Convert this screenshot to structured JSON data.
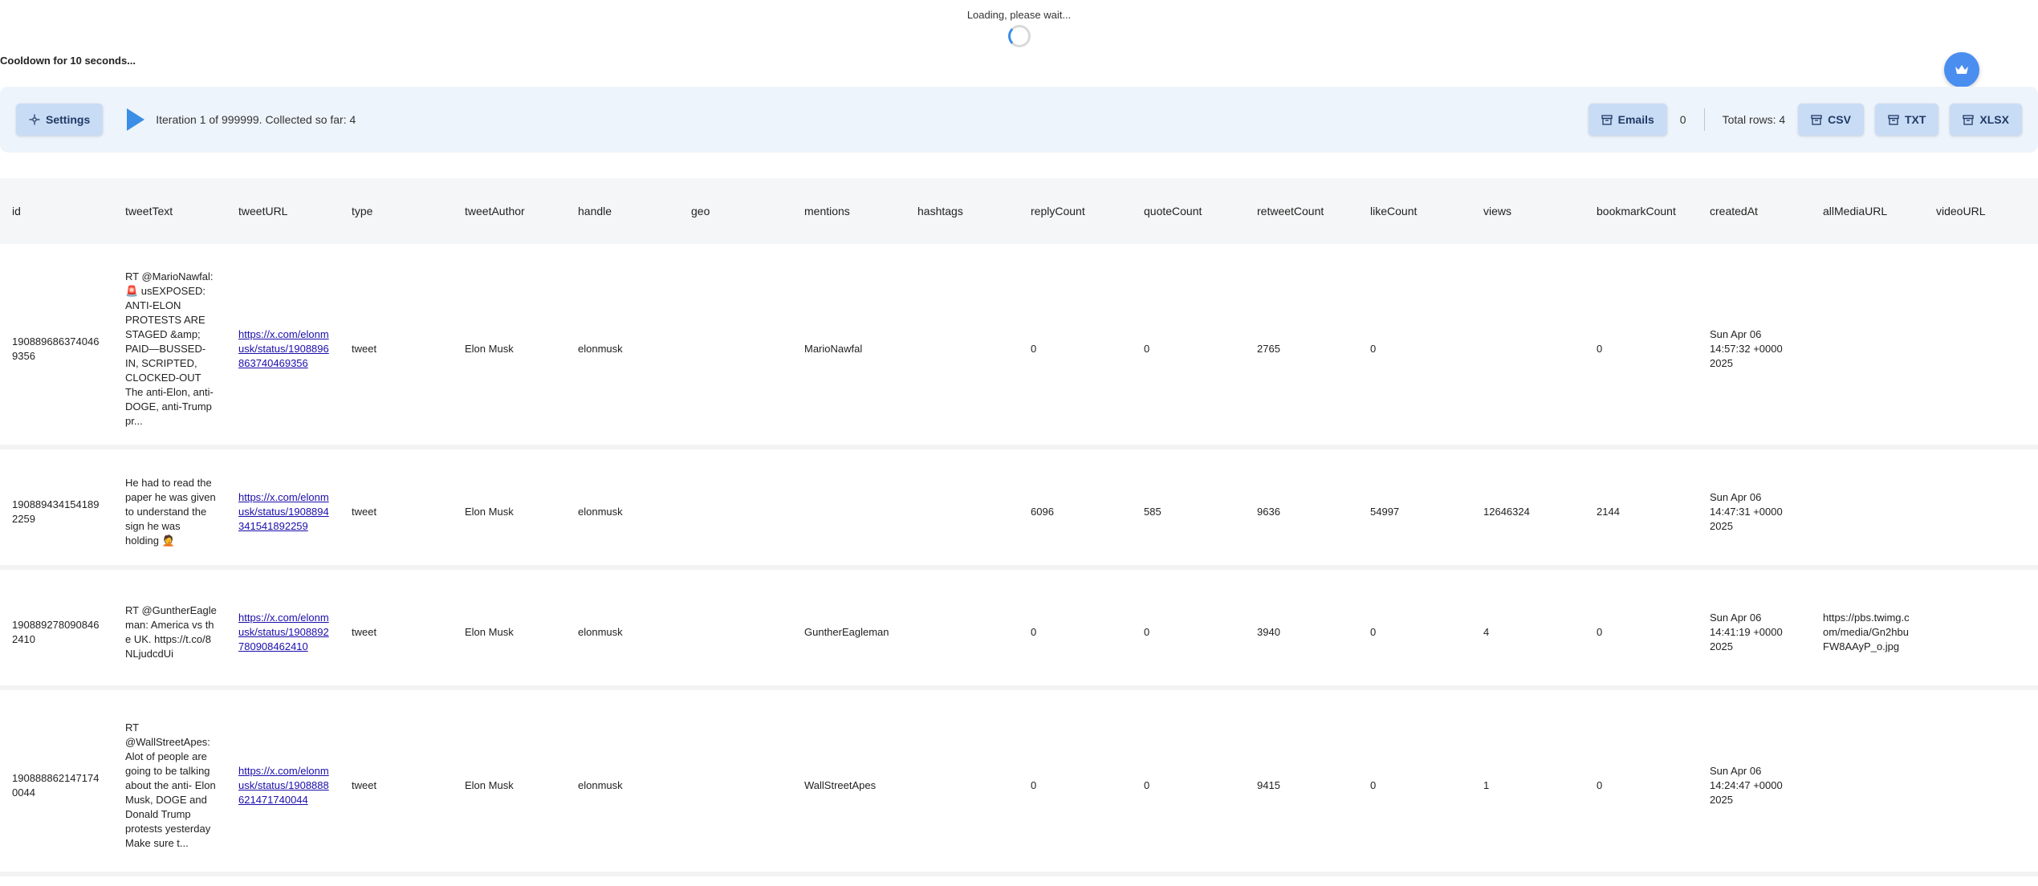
{
  "loading": {
    "text": "Loading, please wait..."
  },
  "cooldown": {
    "text": "Cooldown for 10 seconds..."
  },
  "toolbar": {
    "settings_label": "Settings",
    "iteration_text": "Iteration 1 of 999999. Collected so far: 4",
    "emails_label": "Emails",
    "emails_count": "0",
    "total_rows": "Total rows: 4",
    "csv_label": "CSV",
    "txt_label": "TXT",
    "xlsx_label": "XLSX"
  },
  "table": {
    "headers": [
      "id",
      "tweetText",
      "tweetURL",
      "type",
      "tweetAuthor",
      "handle",
      "geo",
      "mentions",
      "hashtags",
      "replyCount",
      "quoteCount",
      "retweetCount",
      "likeCount",
      "views",
      "bookmarkCount",
      "createdAt",
      "allMediaURL",
      "videoURL"
    ],
    "rows": [
      {
        "id": "1908896863740469356",
        "tweetText": "RT @MarioNawfal: 🚨 usEXPOSED: ANTI-ELON PROTESTS ARE STAGED &amp; PAID—BUSSED-IN, SCRIPTED, CLOCKED-OUT The anti-Elon, anti-DOGE, anti-Trump pr...",
        "tweetURL": "https://x.com/elonmusk/status/1908896863740469356",
        "type": "tweet",
        "tweetAuthor": "Elon Musk",
        "handle": "elonmusk",
        "geo": "",
        "mentions": "MarioNawfal",
        "hashtags": "",
        "replyCount": "0",
        "quoteCount": "0",
        "retweetCount": "2765",
        "likeCount": "0",
        "views": "",
        "bookmarkCount": "0",
        "createdAt": "Sun Apr 06 14:57:32 +0000 2025",
        "allMediaURL": "",
        "videoURL": ""
      },
      {
        "id": "1908894341541892259",
        "tweetText": "He had to read the paper he was given to understand the sign he was holding 🤦",
        "tweetURL": "https://x.com/elonmusk/status/1908894341541892259",
        "type": "tweet",
        "tweetAuthor": "Elon Musk",
        "handle": "elonmusk",
        "geo": "",
        "mentions": "",
        "hashtags": "",
        "replyCount": "6096",
        "quoteCount": "585",
        "retweetCount": "9636",
        "likeCount": "54997",
        "views": "12646324",
        "bookmarkCount": "2144",
        "createdAt": "Sun Apr 06 14:47:31 +0000 2025",
        "allMediaURL": "",
        "videoURL": ""
      },
      {
        "id": "1908892780908462410",
        "tweetText": "RT @GuntherEagleman: America vs the UK. https://t.co/8NLjudcdUi",
        "tweetURL": "https://x.com/elonmusk/status/1908892780908462410",
        "type": "tweet",
        "tweetAuthor": "Elon Musk",
        "handle": "elonmusk",
        "geo": "",
        "mentions": "GuntherEagleman",
        "hashtags": "",
        "replyCount": "0",
        "quoteCount": "0",
        "retweetCount": "3940",
        "likeCount": "0",
        "views": "4",
        "bookmarkCount": "0",
        "createdAt": "Sun Apr 06 14:41:19 +0000 2025",
        "allMediaURL": "https://pbs.twimg.com/media/Gn2hbuFW8AAyP_o.jpg",
        "videoURL": ""
      },
      {
        "id": "1908888621471740044",
        "tweetText": "RT @WallStreetApes: Alot of people are going to be talking about the anti- Elon Musk, DOGE and Donald Trump protests yesterday Make sure t...",
        "tweetURL": "https://x.com/elonmusk/status/1908888621471740044",
        "type": "tweet",
        "tweetAuthor": "Elon Musk",
        "handle": "elonmusk",
        "geo": "",
        "mentions": "WallStreetApes",
        "hashtags": "",
        "replyCount": "0",
        "quoteCount": "0",
        "retweetCount": "9415",
        "likeCount": "0",
        "views": "1",
        "bookmarkCount": "0",
        "createdAt": "Sun Apr 06 14:24:47 +0000 2025",
        "allMediaURL": "",
        "videoURL": ""
      }
    ]
  },
  "colors": {
    "accent": "#3a8ee6",
    "button_bg": "#c9dcf5",
    "toolbar_bg": "#eef4fb"
  },
  "icons": {
    "settings": "crosshair-icon",
    "play": "play-icon",
    "archive": "archive-icon",
    "crown": "crown-icon"
  }
}
